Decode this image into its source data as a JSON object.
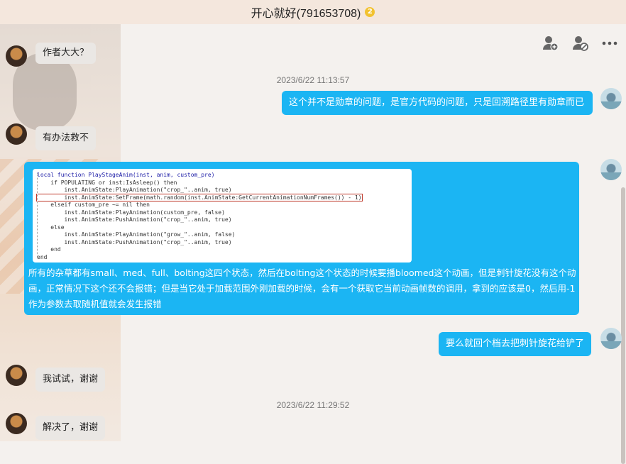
{
  "window": {
    "title": "开心就好(791653708)",
    "badge": "2"
  },
  "toolbar": {
    "icons": [
      "add-friend-icon",
      "block-user-icon",
      "more-icon"
    ]
  },
  "messages": {
    "partial_top": "作者大大？",
    "ts1": "2023/6/22 11:13:57",
    "me1": "这个并不是勋章的问题，是官方代码的问题，只是回溯路径里有勋章而已",
    "friend1": "有办法救不",
    "code_lines": [
      "local function PlayStageAnim(inst, anim, custom_pre)",
      "    if POPULATING or inst:IsAsleep() then",
      "        inst.AnimState:PlayAnimation(\"crop_\"..anim, true)",
      "        inst.AnimState:SetFrame(math.random(inst.AnimState:GetCurrentAnimationNumFrames()) - 1)",
      "    elseif custom_pre ~= nil then",
      "        inst.AnimState:PlayAnimation(custom_pre, false)",
      "        inst.AnimState:PushAnimation(\"crop_\"..anim, true)",
      "    else",
      "        inst.AnimState:PlayAnimation(\"grow_\"..anim, false)",
      "        inst.AnimState:PushAnimation(\"crop_\"..anim, true)",
      "    end",
      "end"
    ],
    "me2": "所有的杂草都有small、med、full、bolting这四个状态，然后在bolting这个状态的时候要播bloomed这个动画，但是刺针旋花没有这个动画，正常情况下这个还不会报错；但是当它处于加载范围外刚加载的时候，会有一个获取它当前动画帧数的调用，拿到的应该是0，然后用-1作为参数去取随机值就会发生报错",
    "me3": "要么就回个档去把刺针旋花给铲了",
    "friend2": "我试试，谢谢",
    "ts2": "2023/6/22 11:29:52",
    "friend3": "解决了，谢谢"
  },
  "colors": {
    "bubble_me": "#1bb5f3",
    "bubble_friend": "#eae7e4"
  }
}
